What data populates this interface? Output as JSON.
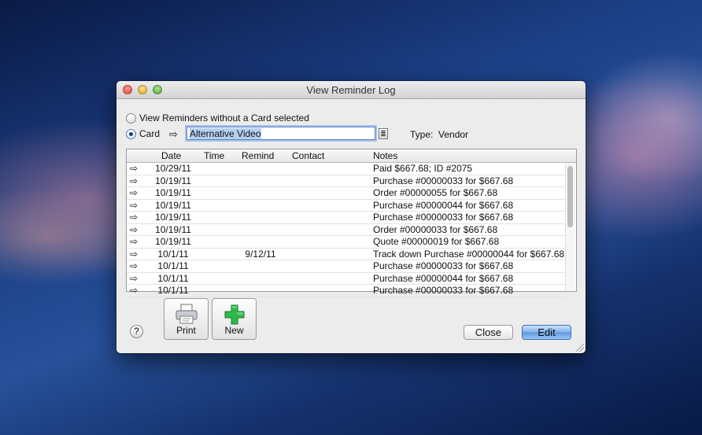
{
  "window": {
    "title": "View Reminder Log"
  },
  "options": {
    "no_card_label": "View Reminders without a Card selected",
    "card_label": "Card",
    "selected": "card"
  },
  "card": {
    "value": "Alternative Video",
    "type_label": "Type:",
    "type_value": "Vendor"
  },
  "table": {
    "columns": {
      "date": "Date",
      "time": "Time",
      "remind": "Remind",
      "contact": "Contact",
      "notes": "Notes"
    },
    "rows": [
      {
        "date": "10/29/11",
        "time": "",
        "remind": "",
        "contact": "",
        "notes": "Paid $667.68; ID #2075"
      },
      {
        "date": "10/19/11",
        "time": "",
        "remind": "",
        "contact": "",
        "notes": "Purchase #00000033 for $667.68"
      },
      {
        "date": "10/19/11",
        "time": "",
        "remind": "",
        "contact": "",
        "notes": "Order #00000055 for $667.68"
      },
      {
        "date": "10/19/11",
        "time": "",
        "remind": "",
        "contact": "",
        "notes": "Purchase #00000044 for $667.68"
      },
      {
        "date": "10/19/11",
        "time": "",
        "remind": "",
        "contact": "",
        "notes": "Purchase #00000033 for $667.68"
      },
      {
        "date": "10/19/11",
        "time": "",
        "remind": "",
        "contact": "",
        "notes": "Order #00000033 for $667.68"
      },
      {
        "date": "10/19/11",
        "time": "",
        "remind": "",
        "contact": "",
        "notes": "Quote #00000019 for $667.68"
      },
      {
        "date": "10/1/11",
        "time": "",
        "remind": "9/12/11",
        "contact": "",
        "notes": "Track down Purchase #00000044 for $667.68"
      },
      {
        "date": "10/1/11",
        "time": "",
        "remind": "",
        "contact": "",
        "notes": "Purchase #00000033 for $667.68"
      },
      {
        "date": "10/1/11",
        "time": "",
        "remind": "",
        "contact": "",
        "notes": "Purchase #00000044 for $667.68"
      },
      {
        "date": "10/1/11",
        "time": "",
        "remind": "",
        "contact": "",
        "notes": "Purchase #00000033 for $667.68"
      }
    ]
  },
  "toolbar": {
    "print_label": "Print",
    "new_label": "New"
  },
  "footer": {
    "help_label": "?",
    "close_label": "Close",
    "edit_label": "Edit"
  },
  "colors": {
    "edit_button": "#6aa3ea",
    "new_plus": "#2eb84a",
    "selection": "#b5d0f0"
  }
}
